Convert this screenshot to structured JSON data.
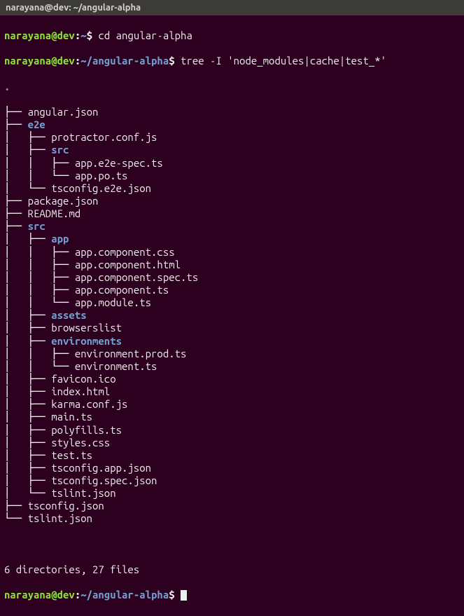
{
  "titlebar": "narayana@dev: ~/angular-alpha",
  "prompt1": {
    "user": "narayana@dev",
    "sep": ":",
    "tilde": "~",
    "dollar": "$ ",
    "cmd": "cd angular-alpha"
  },
  "prompt2": {
    "user": "narayana@dev",
    "sep": ":",
    "path": "~/angular-alpha",
    "dollar": "$ ",
    "cmd": "tree -I 'node_modules|cache|test_*'"
  },
  "dot": ".",
  "tree": [
    {
      "branch": "├── ",
      "name": "angular.json",
      "dir": false
    },
    {
      "branch": "├── ",
      "name": "e2e",
      "dir": true
    },
    {
      "branch": "│   ├── ",
      "name": "protractor.conf.js",
      "dir": false
    },
    {
      "branch": "│   ├── ",
      "name": "src",
      "dir": true
    },
    {
      "branch": "│   │   ├── ",
      "name": "app.e2e-spec.ts",
      "dir": false
    },
    {
      "branch": "│   │   └── ",
      "name": "app.po.ts",
      "dir": false
    },
    {
      "branch": "│   └── ",
      "name": "tsconfig.e2e.json",
      "dir": false
    },
    {
      "branch": "├── ",
      "name": "package.json",
      "dir": false
    },
    {
      "branch": "├── ",
      "name": "README.md",
      "dir": false
    },
    {
      "branch": "├── ",
      "name": "src",
      "dir": true
    },
    {
      "branch": "│   ├── ",
      "name": "app",
      "dir": true
    },
    {
      "branch": "│   │   ├── ",
      "name": "app.component.css",
      "dir": false
    },
    {
      "branch": "│   │   ├── ",
      "name": "app.component.html",
      "dir": false
    },
    {
      "branch": "│   │   ├── ",
      "name": "app.component.spec.ts",
      "dir": false
    },
    {
      "branch": "│   │   ├── ",
      "name": "app.component.ts",
      "dir": false
    },
    {
      "branch": "│   │   └── ",
      "name": "app.module.ts",
      "dir": false
    },
    {
      "branch": "│   ├── ",
      "name": "assets",
      "dir": true
    },
    {
      "branch": "│   ├── ",
      "name": "browserslist",
      "dir": false
    },
    {
      "branch": "│   ├── ",
      "name": "environments",
      "dir": true
    },
    {
      "branch": "│   │   ├── ",
      "name": "environment.prod.ts",
      "dir": false
    },
    {
      "branch": "│   │   └── ",
      "name": "environment.ts",
      "dir": false
    },
    {
      "branch": "│   ├── ",
      "name": "favicon.ico",
      "dir": false
    },
    {
      "branch": "│   ├── ",
      "name": "index.html",
      "dir": false
    },
    {
      "branch": "│   ├── ",
      "name": "karma.conf.js",
      "dir": false
    },
    {
      "branch": "│   ├── ",
      "name": "main.ts",
      "dir": false
    },
    {
      "branch": "│   ├── ",
      "name": "polyfills.ts",
      "dir": false
    },
    {
      "branch": "│   ├── ",
      "name": "styles.css",
      "dir": false
    },
    {
      "branch": "│   ├── ",
      "name": "test.ts",
      "dir": false
    },
    {
      "branch": "│   ├── ",
      "name": "tsconfig.app.json",
      "dir": false
    },
    {
      "branch": "│   ├── ",
      "name": "tsconfig.spec.json",
      "dir": false
    },
    {
      "branch": "│   └── ",
      "name": "tslint.json",
      "dir": false
    },
    {
      "branch": "├── ",
      "name": "tsconfig.json",
      "dir": false
    },
    {
      "branch": "└── ",
      "name": "tslint.json",
      "dir": false
    }
  ],
  "summary": "6 directories, 27 files",
  "prompt3": {
    "user": "narayana@dev",
    "sep": ":",
    "path": "~/angular-alpha",
    "dollar": "$ "
  }
}
